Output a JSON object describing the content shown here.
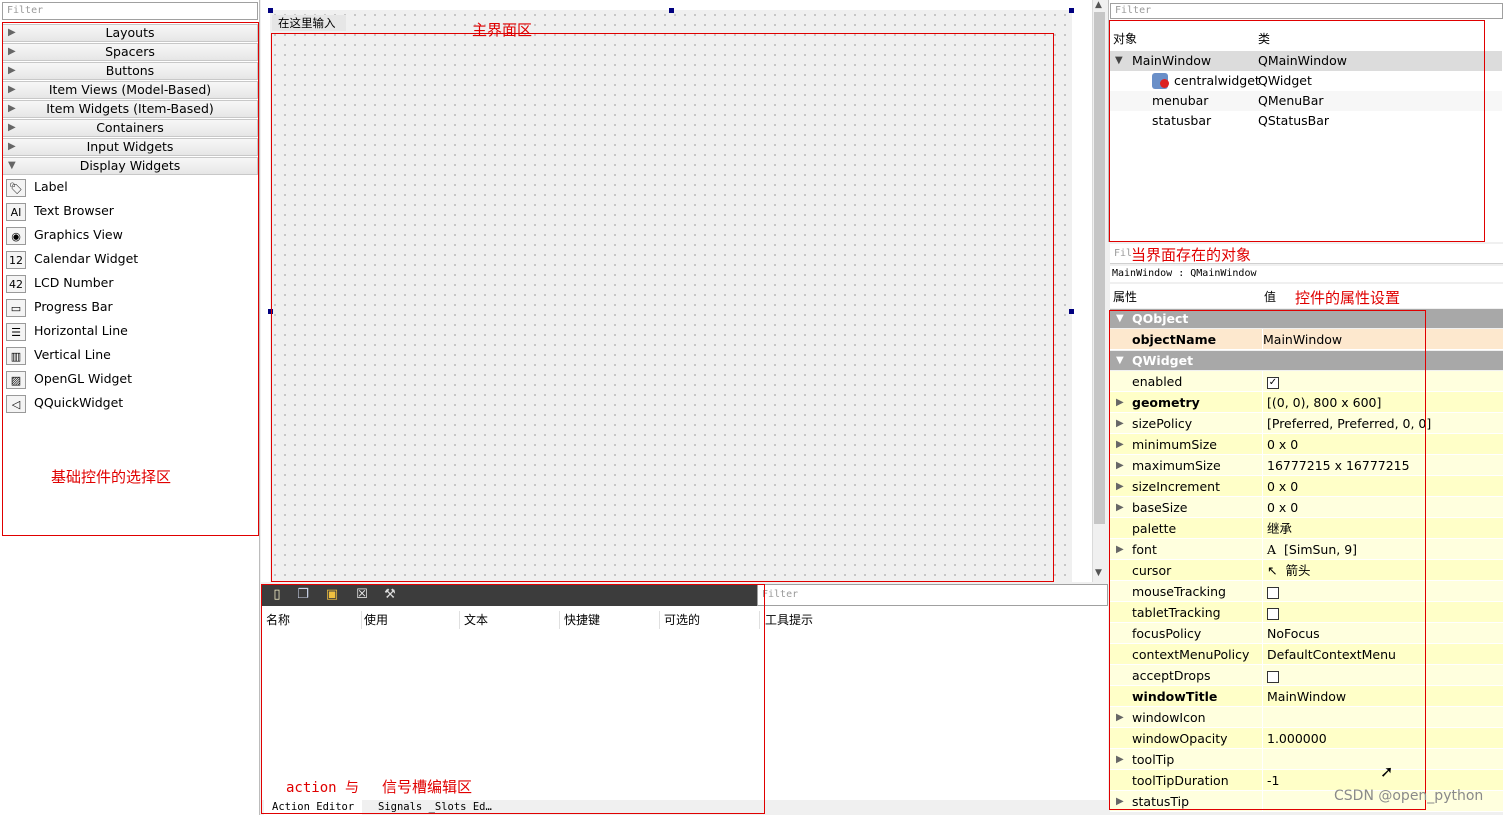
{
  "widget_box": {
    "filter_placeholder": "Filter",
    "categories": [
      "Layouts",
      "Spacers",
      "Buttons",
      "Item Views (Model-Based)",
      "Item Widgets (Item-Based)",
      "Containers",
      "Input Widgets",
      "Display Widgets"
    ],
    "display_widgets": [
      {
        "label": "Label",
        "icon": "label-tag-icon"
      },
      {
        "label": "Text Browser",
        "icon": "text-browser-icon"
      },
      {
        "label": "Graphics View",
        "icon": "graphics-view-icon"
      },
      {
        "label": "Calendar Widget",
        "icon": "calendar-icon"
      },
      {
        "label": "LCD Number",
        "icon": "lcd-number-icon"
      },
      {
        "label": "Progress Bar",
        "icon": "progress-bar-icon"
      },
      {
        "label": "Horizontal Line",
        "icon": "horizontal-line-icon"
      },
      {
        "label": "Vertical Line",
        "icon": "vertical-line-icon"
      },
      {
        "label": "OpenGL Widget",
        "icon": "opengl-widget-icon"
      },
      {
        "label": "QQuickWidget",
        "icon": "qquickwidget-icon"
      }
    ],
    "annotation": "基础控件的选择区"
  },
  "canvas": {
    "menu_placeholder": "在这里输入",
    "annotation": "主界面区"
  },
  "action_editor": {
    "columns": [
      "名称",
      "使用",
      "文本",
      "快捷键",
      "可选的"
    ],
    "tooltip_column": "工具提示",
    "filter_placeholder": "Filter",
    "annotation_left": "action 与",
    "annotation_right": "信号槽编辑区",
    "tabs": [
      "Action Editor",
      "Signals _Slots Ed…"
    ]
  },
  "object_inspector": {
    "filter_placeholder": "Filter",
    "col_object": "对象",
    "col_class": "类",
    "rows": [
      {
        "name": "MainWindow",
        "cls": "QMainWindow"
      },
      {
        "name": "centralwidget",
        "cls": "QWidget"
      },
      {
        "name": "menubar",
        "cls": "QMenuBar"
      },
      {
        "name": "statusbar",
        "cls": "QStatusBar"
      }
    ],
    "annotation": "当界面存在的对象"
  },
  "property_editor": {
    "filter_placeholder": "Fil",
    "class_label": "MainWindow : QMainWindow",
    "col_property": "属性",
    "col_value": "值",
    "annotation": "控件的属性设置",
    "group_qobject": "QObject",
    "group_qwidget": "QWidget",
    "objectName": {
      "name": "objectName",
      "value": "MainWindow"
    },
    "props": [
      {
        "name": "enabled",
        "value": "☑"
      },
      {
        "name": "geometry",
        "value": "[(0, 0), 800 x 600]"
      },
      {
        "name": "sizePolicy",
        "value": "[Preferred, Preferred, 0, 0]"
      },
      {
        "name": "minimumSize",
        "value": "0 x 0"
      },
      {
        "name": "maximumSize",
        "value": "16777215 x 16777215"
      },
      {
        "name": "sizeIncrement",
        "value": "0 x 0"
      },
      {
        "name": "baseSize",
        "value": "0 x 0"
      },
      {
        "name": "palette",
        "value": "继承"
      },
      {
        "name": "font",
        "value": "[SimSun, 9]"
      },
      {
        "name": "cursor",
        "value": "箭头"
      },
      {
        "name": "mouseTracking",
        "value": ""
      },
      {
        "name": "tabletTracking",
        "value": ""
      },
      {
        "name": "focusPolicy",
        "value": "NoFocus"
      },
      {
        "name": "contextMenuPolicy",
        "value": "DefaultContextMenu"
      },
      {
        "name": "acceptDrops",
        "value": ""
      },
      {
        "name": "windowTitle",
        "value": "MainWindow"
      },
      {
        "name": "windowIcon",
        "value": ""
      },
      {
        "name": "windowOpacity",
        "value": "1.000000"
      },
      {
        "name": "toolTip",
        "value": ""
      },
      {
        "name": "toolTipDuration",
        "value": "-1"
      },
      {
        "name": "statusTip",
        "value": ""
      }
    ]
  },
  "watermark": "CSDN @open_python"
}
